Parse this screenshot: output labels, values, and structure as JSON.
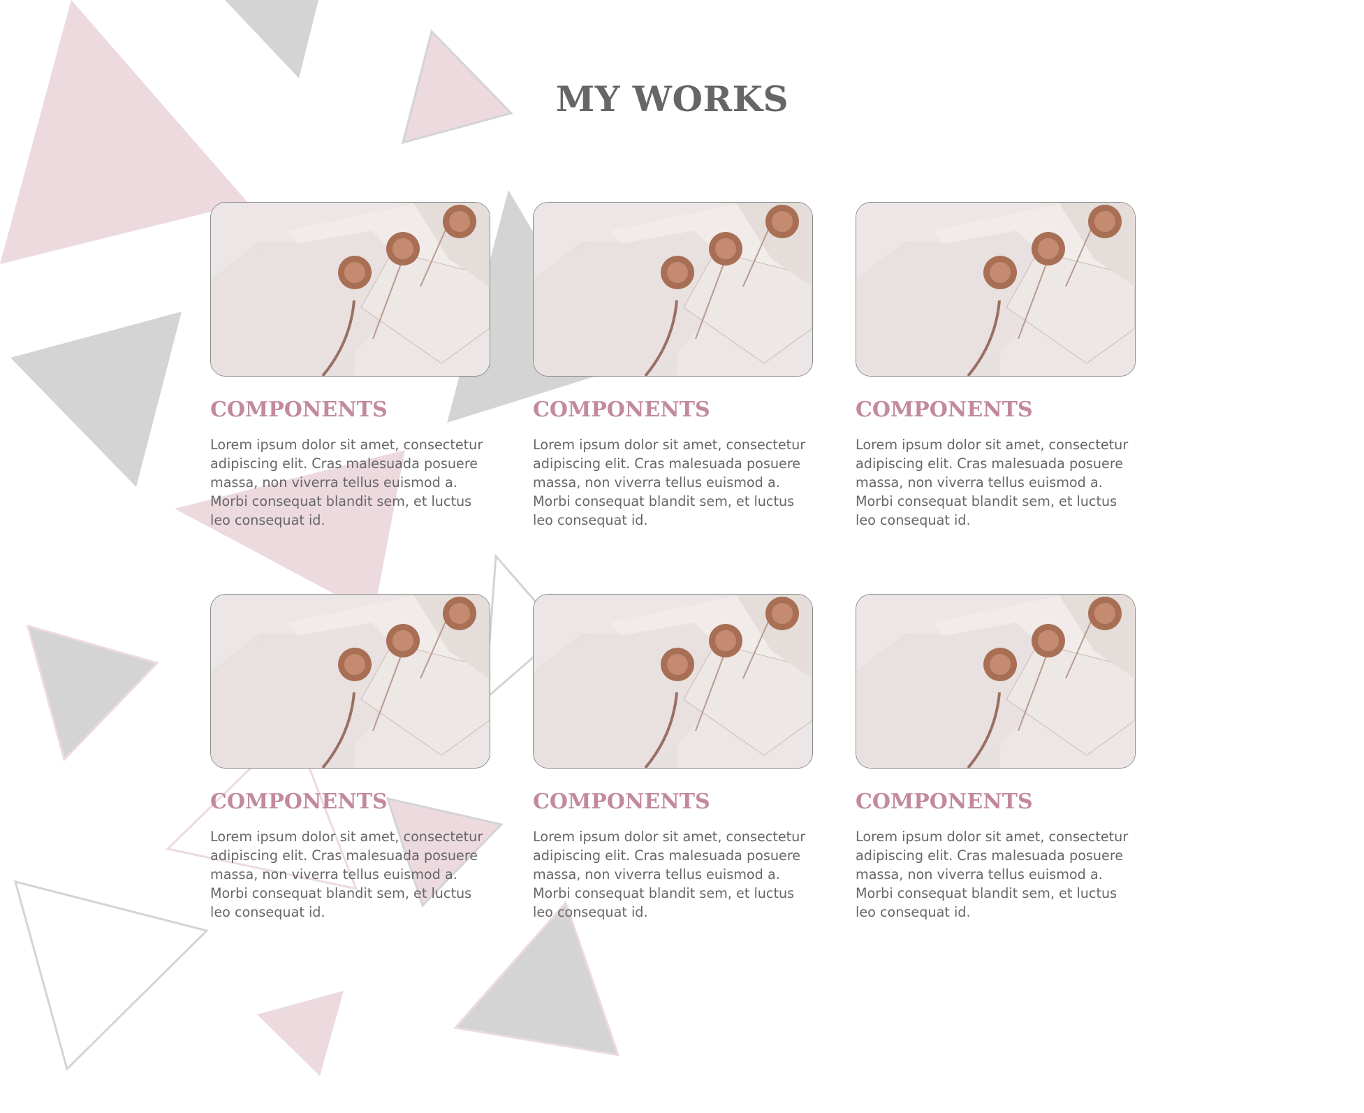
{
  "page": {
    "title": "MY WORKS"
  },
  "colors": {
    "heading": "#666666",
    "accent_pink": "#c28a9c",
    "triangle_pink": "#ecdadf",
    "triangle_gray": "#d4d4d4",
    "body_text": "#666666"
  },
  "works": [
    {
      "title": "COMPONENTS",
      "description": "Lorem ipsum dolor sit amet, consectetur adipiscing elit. Cras malesuada posuere massa, non viverra tellus euismod a. Morbi consequat blandit sem, et luctus leo consequat id."
    },
    {
      "title": "COMPONENTS",
      "description": "Lorem ipsum dolor sit amet, consectetur adipiscing elit. Cras malesuada posuere massa, non viverra tellus euismod a. Morbi consequat blandit sem, et luctus leo consequat id."
    },
    {
      "title": "COMPONENTS",
      "description": "Lorem ipsum dolor sit amet, consectetur adipiscing elit. Cras malesuada posuere massa, non viverra tellus euismod a. Morbi consequat blandit sem, et luctus leo consequat id."
    },
    {
      "title": "COMPONENTS",
      "description": "Lorem ipsum dolor sit amet, consectetur adipiscing elit. Cras malesuada posuere massa, non viverra tellus euismod a. Morbi consequat blandit sem, et luctus leo consequat id."
    },
    {
      "title": "COMPONENTS",
      "description": "Lorem ipsum dolor sit amet, consectetur adipiscing elit. Cras malesuada posuere massa, non viverra tellus euismod a. Morbi consequat blandit sem, et luctus leo consequat id."
    },
    {
      "title": "COMPONENTS",
      "description": "Lorem ipsum dolor sit amet, consectetur adipiscing elit. Cras malesuada posuere massa, non viverra tellus euismod a. Morbi consequat blandit sem, et luctus leo consequat id."
    }
  ]
}
